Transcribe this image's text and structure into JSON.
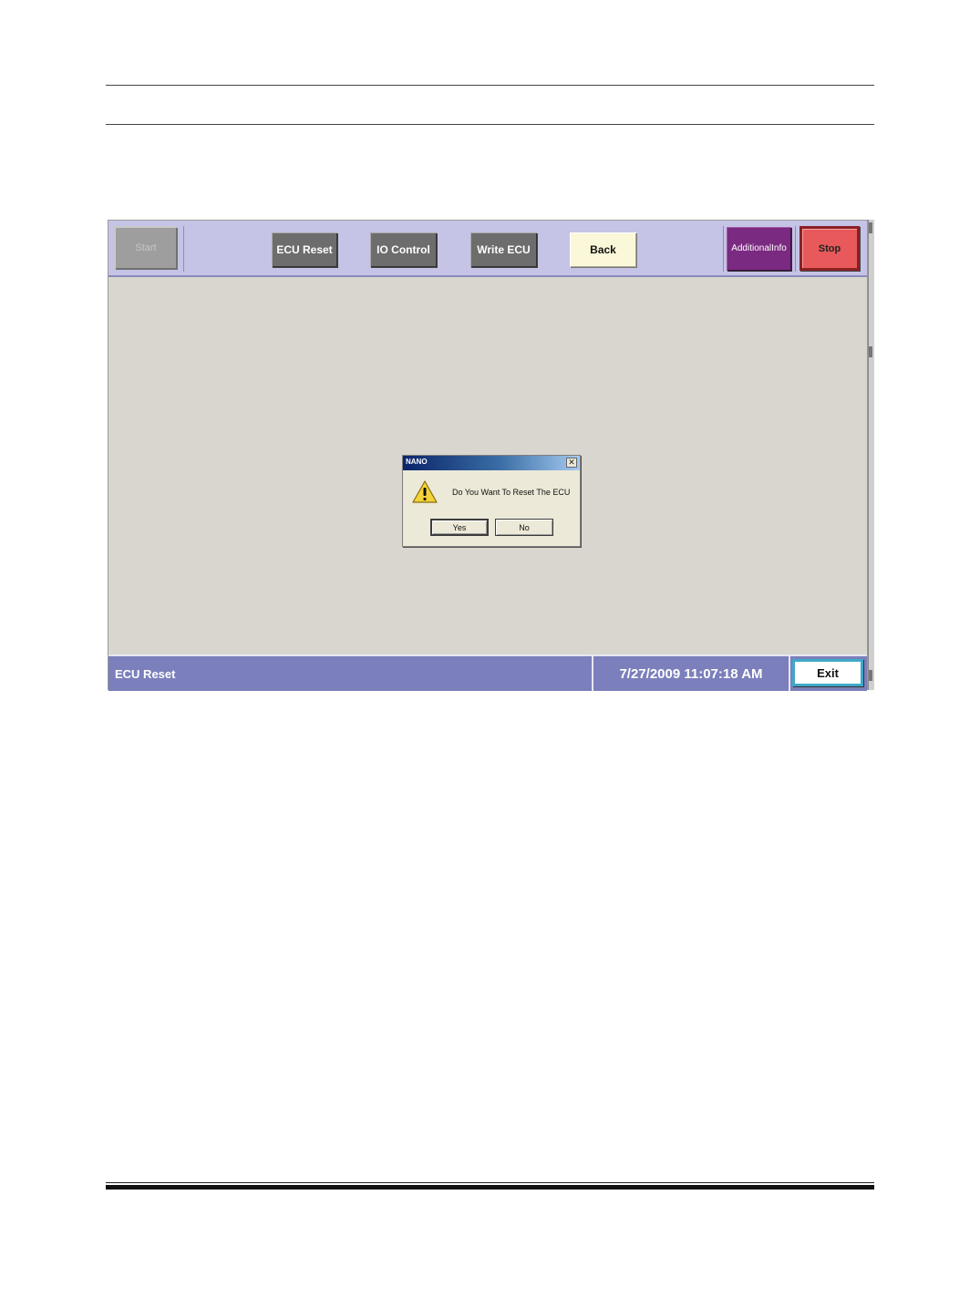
{
  "toolbar": {
    "start_label": "Start",
    "ecu_reset_label": "ECU Reset",
    "io_control_label": "IO Control",
    "write_ecu_label": "Write ECU",
    "back_label": "Back",
    "additional_info_line1": "Additional",
    "additional_info_line2": "Info",
    "stop_label": "Stop"
  },
  "dialog": {
    "title": "NANO",
    "close_glyph": "✕",
    "message": "Do You Want To Reset The ECU",
    "icon": "warning-icon",
    "yes_label": "Yes",
    "no_label": "No"
  },
  "statusbar": {
    "screen_label": "ECU Reset",
    "datetime": "7/27/2009 11:07:18 AM",
    "exit_label": "Exit"
  },
  "colors": {
    "toolbar_bg": "#c5c3e6",
    "content_bg": "#d9d6cf",
    "statusbar_bg": "#7b7fbb",
    "stop_button": "#e8595b",
    "additional_info_button": "#7a2a80",
    "back_button": "#fbf8d9",
    "exit_border": "#3fa8c8"
  }
}
